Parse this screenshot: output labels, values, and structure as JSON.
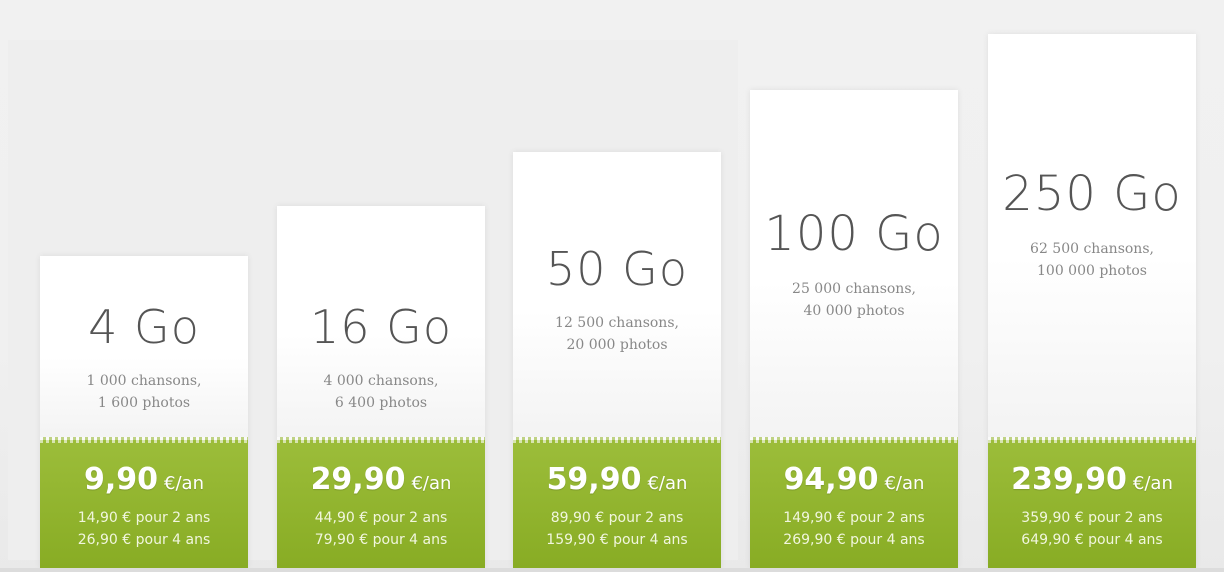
{
  "plans": [
    {
      "capacity": "4 Go",
      "desc_line1": "1 000 chansons,",
      "desc_line2": "1 600 photos",
      "price": "9,90",
      "per": "€/an",
      "two_years": "14,90 € pour 2 ans",
      "four_years": "26,90 € pour 4 ans"
    },
    {
      "capacity": "16 Go",
      "desc_line1": "4 000 chansons,",
      "desc_line2": "6 400 photos",
      "price": "29,90",
      "per": "€/an",
      "two_years": "44,90 € pour 2 ans",
      "four_years": "79,90 € pour 4 ans"
    },
    {
      "capacity": "50 Go",
      "desc_line1": "12 500 chansons,",
      "desc_line2": "20 000 photos",
      "price": "59,90",
      "per": "€/an",
      "two_years": "89,90 € pour 2 ans",
      "four_years": "159,90 € pour 4 ans"
    },
    {
      "capacity": "100 Go",
      "desc_line1": "25 000 chansons,",
      "desc_line2": "40 000 photos",
      "price": "94,90",
      "per": "€/an",
      "two_years": "149,90 € pour 2 ans",
      "four_years": "269,90 € pour 4 ans"
    },
    {
      "capacity": "250 Go",
      "desc_line1": "62 500 chansons,",
      "desc_line2": "100 000 photos",
      "price": "239,90",
      "per": "€/an",
      "two_years": "359,90 € pour 2 ans",
      "four_years": "649,90 € pour 4 ans"
    }
  ],
  "colors": {
    "accent_green": "#8fb12b",
    "card_white": "#ffffff",
    "capacity_text": "#555555",
    "desc_text": "#888888"
  }
}
